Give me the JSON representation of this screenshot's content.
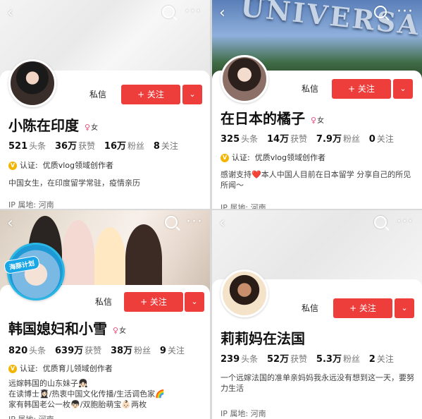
{
  "common": {
    "back_icon": "‹",
    "more_icon": "···",
    "message_label": "私信",
    "follow_label": "+ 关注",
    "dropdown_icon": "⌄",
    "verify_label": "认证:",
    "gender_label": "女",
    "stat_labels": {
      "posts": "头条",
      "likes": "获赞",
      "fans": "粉丝",
      "following": "关注"
    }
  },
  "profiles": [
    {
      "name": "小陈在印度",
      "stats": {
        "posts": "521",
        "likes": "36万",
        "fans": "16万",
        "following": "8"
      },
      "verification": "优质vlog领域创作者",
      "bio": "中国女生，在印度留学常驻，疫情亲历",
      "ip": "IP 属地: 河南"
    },
    {
      "name": "在日本的橘子",
      "banner_text": "UNIVERSA",
      "stats": {
        "posts": "325",
        "likes": "14万",
        "fans": "7.9万",
        "following": "0"
      },
      "verification": "优质vlog领域创作者",
      "bio": "感谢支持❤️本人中国人目前在日本留学 分享自己的所见所闻～",
      "ip": "IP 属地: 河南"
    },
    {
      "name": "韩国媳妇和小雪",
      "badge": "海豚计划",
      "stats": {
        "posts": "820",
        "likes": "639万",
        "fans": "38万",
        "following": "9"
      },
      "verification": "优质育儿领域创作者",
      "bio_lines": [
        "远嫁韩国的山东妹子👧🏻",
        "在读博士👩🏻‍🎓/热衷中国文化传播/生活调色家🌈",
        "家有韩国老公一枚👦🏻/双胞胎萌宝👶🏻两枚"
      ],
      "ip": "IP 属地: 河南"
    },
    {
      "name": "莉莉妈在法国",
      "stats": {
        "posts": "239",
        "likes": "52万",
        "fans": "5.3万",
        "following": "2"
      },
      "bio": "一个远嫁法国的准单亲妈妈我永远没有想到这一天，要努力生活",
      "ip": "IP 属地: 河南"
    }
  ]
}
